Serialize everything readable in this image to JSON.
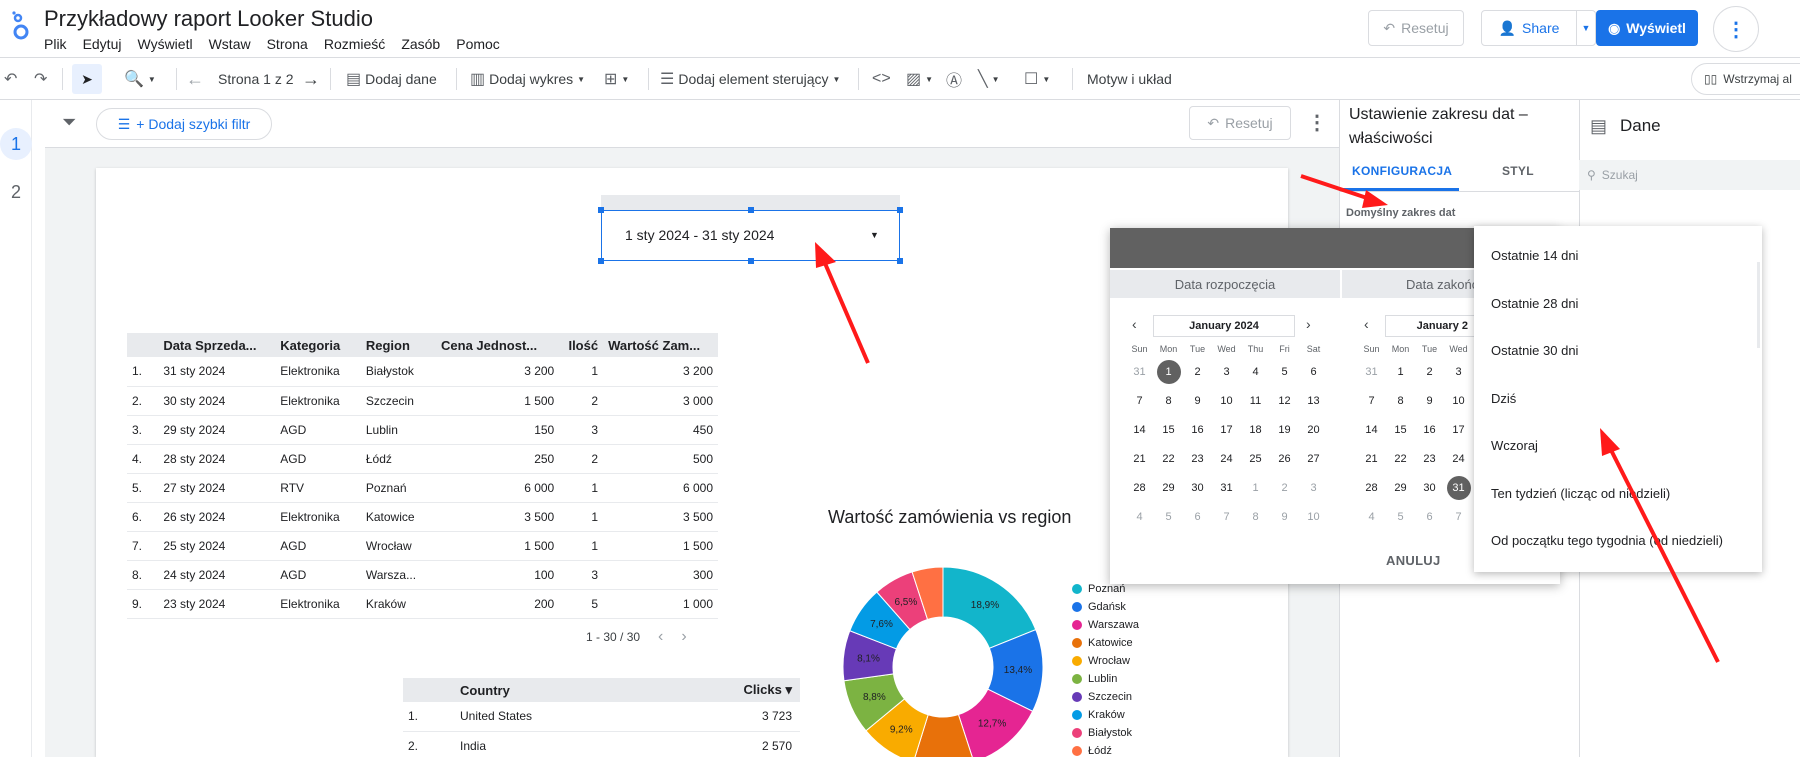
{
  "app": {
    "title": "Przykładowy raport Looker Studio",
    "menu": [
      "Plik",
      "Edytuj",
      "Wyświetl",
      "Wstaw",
      "Strona",
      "Rozmieść",
      "Zasób",
      "Pomoc"
    ],
    "reset_label": "Resetuj",
    "share_label": "Share",
    "view_label": "Wyświetl"
  },
  "toolbar": {
    "page_label": "Strona 1 z 2",
    "add_data": "Dodaj dane",
    "add_chart": "Dodaj wykres",
    "add_control": "Dodaj element sterujący",
    "theme": "Motyw i układ",
    "pause": "Wstrzymaj al"
  },
  "pages": [
    "1",
    "2"
  ],
  "filterbar": {
    "quick_filter": "+ Dodaj szybki filtr",
    "reset_label": "Resetuj"
  },
  "date_control": {
    "value": "1 sty 2024 - 31 sty 2024"
  },
  "sales_table": {
    "columns": [
      "Data Sprzeda...",
      "Kategoria",
      "Region",
      "Cena Jednost...",
      "Ilość",
      "Wartość Zam..."
    ],
    "rows": [
      [
        "1.",
        "31 sty 2024",
        "Elektronika",
        "Białystok",
        "3 200",
        "1",
        "3 200"
      ],
      [
        "2.",
        "30 sty 2024",
        "Elektronika",
        "Szczecin",
        "1 500",
        "2",
        "3 000"
      ],
      [
        "3.",
        "29 sty 2024",
        "AGD",
        "Lublin",
        "150",
        "3",
        "450"
      ],
      [
        "4.",
        "28 sty 2024",
        "AGD",
        "Łódź",
        "250",
        "2",
        "500"
      ],
      [
        "5.",
        "27 sty 2024",
        "RTV",
        "Poznań",
        "6 000",
        "1",
        "6 000"
      ],
      [
        "6.",
        "26 sty 2024",
        "Elektronika",
        "Katowice",
        "3 500",
        "1",
        "3 500"
      ],
      [
        "7.",
        "25 sty 2024",
        "AGD",
        "Wrocław",
        "1 500",
        "1",
        "1 500"
      ],
      [
        "8.",
        "24 sty 2024",
        "AGD",
        "Warsza...",
        "100",
        "3",
        "300"
      ],
      [
        "9.",
        "23 sty 2024",
        "Elektronika",
        "Kraków",
        "200",
        "5",
        "1 000"
      ]
    ],
    "pagination": "1 - 30 / 30"
  },
  "country_table": {
    "columns": [
      "Country",
      "Clicks ▾"
    ],
    "rows": [
      [
        "1.",
        "United States",
        "3 723"
      ],
      [
        "2.",
        "India",
        "2 570"
      ]
    ]
  },
  "chart_data": {
    "type": "pie",
    "title": "Wartość zamówienia vs region",
    "donut": true,
    "categories": [
      "Poznań",
      "Gdańsk",
      "Warszawa",
      "Katowice",
      "Wrocław",
      "Lublin",
      "Szczecin",
      "Kraków",
      "Białystok",
      "Łódź"
    ],
    "values": [
      18.9,
      13.4,
      12.7,
      9.8,
      9.2,
      8.8,
      8.1,
      7.6,
      6.5,
      5.0
    ],
    "labels": [
      "18,9%",
      "13,4%",
      "12,7%",
      "",
      "9,2%",
      "8,8%",
      "8,1%",
      "7,6%",
      "6,5%",
      ""
    ],
    "colors": [
      "#12b5cb",
      "#1a73e8",
      "#e52592",
      "#e8710a",
      "#f9ab00",
      "#7cb342",
      "#673ab7",
      "#039be5",
      "#ec407a",
      "#ff7043"
    ],
    "legend_position": "right"
  },
  "properties": {
    "title": "Ustawienie zakresu dat – właściwości",
    "tab_config": "KONFIGURACJA",
    "tab_style": "STYL",
    "default_range": "Domyślny zakres dat"
  },
  "data_panel": {
    "title": "Dane",
    "search_placeholder": "Szukaj"
  },
  "picker": {
    "start_label": "Data rozpoczęcia",
    "end_label": "Data zakończ",
    "start_month": "January 2024",
    "end_month": "January 2",
    "weekdays": [
      "Sun",
      "Mon",
      "Tue",
      "Wed",
      "Thu",
      "Fri",
      "Sat"
    ],
    "cancel": "ANULUJ"
  },
  "presets": [
    "Ostatnie 14 dni",
    "Ostatnie 28 dni",
    "Ostatnie 30 dni",
    "Dziś",
    "Wczoraj",
    "Ten tydzień (licząc od niedzieli)",
    "Od początku tego tygodnia (od niedzieli)"
  ],
  "colors": {
    "accent": "#1a73e8",
    "annotation_arrow": "#ff1a1a"
  }
}
